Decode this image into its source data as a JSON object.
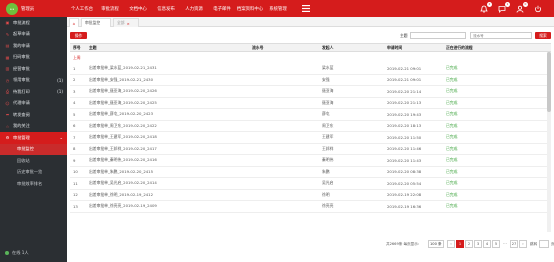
{
  "header": {
    "logo_badge": "e.s",
    "app_title": "管理员",
    "nav": [
      "个人工作台",
      "审批流程",
      "文档中心",
      "信息发布",
      "人力资源",
      "电子邮件",
      "档案资料中心",
      "系统管理"
    ],
    "notification_counts": [
      "2",
      "1",
      "0"
    ]
  },
  "sidebar": {
    "items": [
      {
        "label": "审批流程",
        "count": ""
      },
      {
        "label": "起草申请",
        "count": ""
      },
      {
        "label": "我的申请",
        "count": ""
      },
      {
        "label": "扫码审批",
        "count": ""
      },
      {
        "label": "经营审批",
        "count": ""
      },
      {
        "label": "领用审批",
        "count": "(1)"
      },
      {
        "label": "待我打印",
        "count": "(1)"
      },
      {
        "label": "代理申请",
        "count": ""
      },
      {
        "label": "转发查阅",
        "count": ""
      },
      {
        "label": "我的关注",
        "count": ""
      },
      {
        "label": "审批管理",
        "count": ""
      }
    ],
    "sub_items": [
      "审批监控",
      "回收站",
      "历史审批一览",
      "审批效率排名"
    ],
    "online_text": "在线 1人"
  },
  "tabs": {
    "items": [
      "审批监控",
      "全部"
    ]
  },
  "toolbar": {
    "action_label": "操作",
    "filter_subject_label": "主题",
    "filter_flow_placeholder": "流水号",
    "search_label": "搜索"
  },
  "table": {
    "columns": [
      "序号",
      "主题",
      "流水号",
      "发起人",
      "申请时间",
      "正在进行的流程"
    ],
    "group_label": "上周",
    "rows": [
      {
        "no": "1",
        "title": "出差审批单_梁水蓝_2019-02-21_2431",
        "step": "",
        "user": "梁水蓝",
        "time": "2019-02-21 09:01",
        "status": "已完成"
      },
      {
        "no": "2",
        "title": "出差审批单_安强_2019-02-21_2430",
        "step": "",
        "user": "安强",
        "time": "2019-02-21 09:01",
        "status": "已完成"
      },
      {
        "no": "3",
        "title": "出差审批单_聂亚海_2019-02-20_2426",
        "step": "",
        "user": "聂亚海",
        "time": "2019-02-20 21:14",
        "status": "已完成"
      },
      {
        "no": "4",
        "title": "出差审批单_聂亚海_2019-02-20_2425",
        "step": "",
        "user": "聂亚海",
        "time": "2019-02-20 21:13",
        "status": "已完成"
      },
      {
        "no": "5",
        "title": "出差审批单_薛屯_2019-02-20_2423",
        "step": "",
        "user": "薛屯",
        "time": "2019-02-20 19:43",
        "status": "已完成"
      },
      {
        "no": "6",
        "title": "出差审批单_周卫东_2019-02-20_2422",
        "step": "",
        "user": "周卫东",
        "time": "2019-02-20 18:13",
        "status": "已完成"
      },
      {
        "no": "7",
        "title": "出差审批单_王建军_2019-02-20_2418",
        "step": "",
        "user": "王建军",
        "time": "2019-02-20 11:50",
        "status": "已完成"
      },
      {
        "no": "8",
        "title": "出差审批单_王邦祥_2019-02-20_2417",
        "step": "",
        "user": "王邦祥",
        "time": "2019-02-20 11:46",
        "status": "已完成"
      },
      {
        "no": "9",
        "title": "出差审批单_秦明伟_2019-02-20_2416",
        "step": "",
        "user": "秦明伟",
        "time": "2019-02-20 11:43",
        "status": "已完成"
      },
      {
        "no": "10",
        "title": "出差审批单_朱鹏_2019-02-20_2415",
        "step": "",
        "user": "朱鹏",
        "time": "2019-02-20 08:38",
        "status": "已完成"
      },
      {
        "no": "11",
        "title": "出差审批单_吴光启_2019-02-20_2414",
        "step": "",
        "user": "吴光启",
        "time": "2019-02-20 05:54",
        "status": "已完成"
      },
      {
        "no": "12",
        "title": "出差审批单_徐明_2019-02-19_2412",
        "step": "",
        "user": "徐明",
        "time": "2019-02-19 22:08",
        "status": "已完成"
      },
      {
        "no": "13",
        "title": "出差审批单_徐亮亮_2019-02-19_2409",
        "step": "",
        "user": "徐亮亮",
        "time": "2019-02-19 16:36",
        "status": "已完成"
      }
    ]
  },
  "pager": {
    "total_text": "共2669条 每页显示：",
    "page_size": "100 条",
    "pages": [
      "1",
      "2",
      "3",
      "4",
      "5",
      "...",
      "27"
    ],
    "goto_label": "跳转",
    "goto_suffix": "页"
  },
  "colors": {
    "brand_red": "#d51c1c",
    "sidebar_bg": "#2b2f33",
    "status_green": "#3ba33b"
  }
}
